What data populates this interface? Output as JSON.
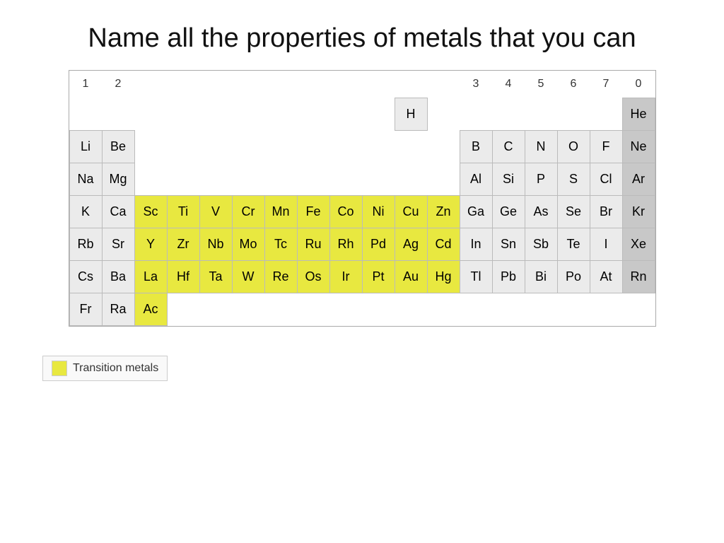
{
  "title": "Name all the properties of metals that you can",
  "legend": {
    "label": "Transition metals"
  },
  "table": {
    "group_headers": [
      "1",
      "2",
      "",
      "3",
      "4",
      "5",
      "6",
      "7",
      "0"
    ],
    "rows": [
      {
        "cells": [
          {
            "symbol": "",
            "type": "empty"
          },
          {
            "symbol": "",
            "type": "empty"
          },
          {
            "symbol": "",
            "type": "empty"
          },
          {
            "symbol": "",
            "type": "empty"
          },
          {
            "symbol": "",
            "type": "empty"
          },
          {
            "symbol": "",
            "type": "empty"
          },
          {
            "symbol": "",
            "type": "empty"
          },
          {
            "symbol": "",
            "type": "empty"
          },
          {
            "symbol": "",
            "type": "empty"
          },
          {
            "symbol": "",
            "type": "empty"
          },
          {
            "symbol": "H",
            "type": "cell-h"
          },
          {
            "symbol": "",
            "type": "empty"
          },
          {
            "symbol": "",
            "type": "empty"
          },
          {
            "symbol": "",
            "type": "empty"
          },
          {
            "symbol": "",
            "type": "empty"
          },
          {
            "symbol": "",
            "type": "empty"
          },
          {
            "symbol": "",
            "type": "empty"
          },
          {
            "symbol": "He",
            "type": "cell-light"
          }
        ]
      },
      {
        "cells": [
          {
            "symbol": "Li",
            "type": "cell"
          },
          {
            "symbol": "Be",
            "type": "cell"
          },
          {
            "symbol": "",
            "type": "empty"
          },
          {
            "symbol": "",
            "type": "empty"
          },
          {
            "symbol": "",
            "type": "empty"
          },
          {
            "symbol": "",
            "type": "empty"
          },
          {
            "symbol": "",
            "type": "empty"
          },
          {
            "symbol": "",
            "type": "empty"
          },
          {
            "symbol": "",
            "type": "empty"
          },
          {
            "symbol": "",
            "type": "empty"
          },
          {
            "symbol": "",
            "type": "empty"
          },
          {
            "symbol": "",
            "type": "empty"
          },
          {
            "symbol": "B",
            "type": "cell"
          },
          {
            "symbol": "C",
            "type": "cell"
          },
          {
            "symbol": "N",
            "type": "cell"
          },
          {
            "symbol": "O",
            "type": "cell"
          },
          {
            "symbol": "F",
            "type": "cell"
          },
          {
            "symbol": "Ne",
            "type": "cell-light"
          }
        ]
      },
      {
        "cells": [
          {
            "symbol": "Na",
            "type": "cell"
          },
          {
            "symbol": "Mg",
            "type": "cell"
          },
          {
            "symbol": "",
            "type": "empty"
          },
          {
            "symbol": "",
            "type": "empty"
          },
          {
            "symbol": "",
            "type": "empty"
          },
          {
            "symbol": "",
            "type": "empty"
          },
          {
            "symbol": "",
            "type": "empty"
          },
          {
            "symbol": "",
            "type": "empty"
          },
          {
            "symbol": "",
            "type": "empty"
          },
          {
            "symbol": "",
            "type": "empty"
          },
          {
            "symbol": "",
            "type": "empty"
          },
          {
            "symbol": "",
            "type": "empty"
          },
          {
            "symbol": "Al",
            "type": "cell"
          },
          {
            "symbol": "Si",
            "type": "cell"
          },
          {
            "symbol": "P",
            "type": "cell"
          },
          {
            "symbol": "S",
            "type": "cell"
          },
          {
            "symbol": "Cl",
            "type": "cell"
          },
          {
            "symbol": "Ar",
            "type": "cell-light"
          }
        ]
      },
      {
        "cells": [
          {
            "symbol": "K",
            "type": "cell"
          },
          {
            "symbol": "Ca",
            "type": "cell"
          },
          {
            "symbol": "Sc",
            "type": "cell-yellow"
          },
          {
            "symbol": "Ti",
            "type": "cell-yellow"
          },
          {
            "symbol": "V",
            "type": "cell-yellow"
          },
          {
            "symbol": "Cr",
            "type": "cell-yellow"
          },
          {
            "symbol": "Mn",
            "type": "cell-yellow"
          },
          {
            "symbol": "Fe",
            "type": "cell-yellow"
          },
          {
            "symbol": "Co",
            "type": "cell-yellow"
          },
          {
            "symbol": "Ni",
            "type": "cell-yellow"
          },
          {
            "symbol": "Cu",
            "type": "cell-yellow"
          },
          {
            "symbol": "Zn",
            "type": "cell-yellow"
          },
          {
            "symbol": "Ga",
            "type": "cell"
          },
          {
            "symbol": "Ge",
            "type": "cell"
          },
          {
            "symbol": "As",
            "type": "cell"
          },
          {
            "symbol": "Se",
            "type": "cell"
          },
          {
            "symbol": "Br",
            "type": "cell"
          },
          {
            "symbol": "Kr",
            "type": "cell-light"
          }
        ]
      },
      {
        "cells": [
          {
            "symbol": "Rb",
            "type": "cell"
          },
          {
            "symbol": "Sr",
            "type": "cell"
          },
          {
            "symbol": "Y",
            "type": "cell-yellow"
          },
          {
            "symbol": "Zr",
            "type": "cell-yellow"
          },
          {
            "symbol": "Nb",
            "type": "cell-yellow"
          },
          {
            "symbol": "Mo",
            "type": "cell-yellow"
          },
          {
            "symbol": "Tc",
            "type": "cell-yellow"
          },
          {
            "symbol": "Ru",
            "type": "cell-yellow"
          },
          {
            "symbol": "Rh",
            "type": "cell-yellow"
          },
          {
            "symbol": "Pd",
            "type": "cell-yellow"
          },
          {
            "symbol": "Ag",
            "type": "cell-yellow"
          },
          {
            "symbol": "Cd",
            "type": "cell-yellow"
          },
          {
            "symbol": "In",
            "type": "cell"
          },
          {
            "symbol": "Sn",
            "type": "cell"
          },
          {
            "symbol": "Sb",
            "type": "cell"
          },
          {
            "symbol": "Te",
            "type": "cell"
          },
          {
            "symbol": "I",
            "type": "cell"
          },
          {
            "symbol": "Xe",
            "type": "cell-light"
          }
        ]
      },
      {
        "cells": [
          {
            "symbol": "Cs",
            "type": "cell"
          },
          {
            "symbol": "Ba",
            "type": "cell"
          },
          {
            "symbol": "La",
            "type": "cell-yellow"
          },
          {
            "symbol": "Hf",
            "type": "cell-yellow"
          },
          {
            "symbol": "Ta",
            "type": "cell-yellow"
          },
          {
            "symbol": "W",
            "type": "cell-yellow"
          },
          {
            "symbol": "Re",
            "type": "cell-yellow"
          },
          {
            "symbol": "Os",
            "type": "cell-yellow"
          },
          {
            "symbol": "Ir",
            "type": "cell-yellow"
          },
          {
            "symbol": "Pt",
            "type": "cell-yellow"
          },
          {
            "symbol": "Au",
            "type": "cell-yellow"
          },
          {
            "symbol": "Hg",
            "type": "cell-yellow"
          },
          {
            "symbol": "Tl",
            "type": "cell"
          },
          {
            "symbol": "Pb",
            "type": "cell"
          },
          {
            "symbol": "Bi",
            "type": "cell"
          },
          {
            "symbol": "Po",
            "type": "cell"
          },
          {
            "symbol": "At",
            "type": "cell"
          },
          {
            "symbol": "Rn",
            "type": "cell-light"
          }
        ]
      },
      {
        "cells": [
          {
            "symbol": "Fr",
            "type": "cell"
          },
          {
            "symbol": "Ra",
            "type": "cell"
          },
          {
            "symbol": "Ac",
            "type": "cell-yellow"
          },
          {
            "symbol": "",
            "type": "empty"
          },
          {
            "symbol": "",
            "type": "empty"
          },
          {
            "symbol": "",
            "type": "empty"
          },
          {
            "symbol": "",
            "type": "empty"
          },
          {
            "symbol": "",
            "type": "empty"
          },
          {
            "symbol": "",
            "type": "empty"
          },
          {
            "symbol": "",
            "type": "empty"
          },
          {
            "symbol": "",
            "type": "empty"
          },
          {
            "symbol": "",
            "type": "empty"
          },
          {
            "symbol": "",
            "type": "empty"
          },
          {
            "symbol": "",
            "type": "empty"
          },
          {
            "symbol": "",
            "type": "empty"
          },
          {
            "symbol": "",
            "type": "empty"
          },
          {
            "symbol": "",
            "type": "empty"
          },
          {
            "symbol": "",
            "type": "empty"
          }
        ]
      }
    ]
  }
}
